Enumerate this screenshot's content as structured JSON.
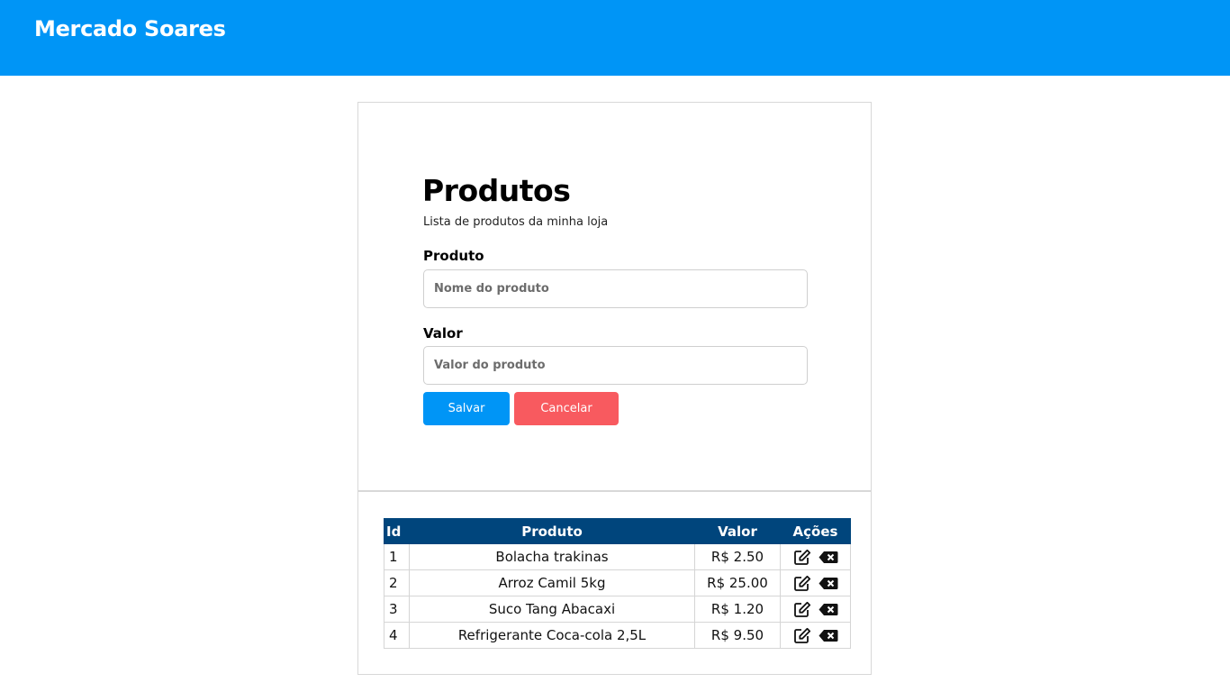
{
  "header": {
    "brand": "Mercado Soares"
  },
  "form": {
    "title": "Produtos",
    "subtitle": "Lista de produtos da minha loja",
    "product_label": "Produto",
    "product_placeholder": "Nome do produto",
    "value_label": "Valor",
    "value_placeholder": "Valor do produto",
    "save_label": "Salvar",
    "cancel_label": "Cancelar"
  },
  "table": {
    "headers": [
      "Id",
      "Produto",
      "Valor",
      "Ações"
    ],
    "rows": [
      {
        "id": "1",
        "produto": "Bolacha trakinas",
        "valor": "R$ 2.50"
      },
      {
        "id": "2",
        "produto": "Arroz Camil 5kg",
        "valor": "R$ 25.00"
      },
      {
        "id": "3",
        "produto": "Suco Tang Abacaxi",
        "valor": "R$ 1.20"
      },
      {
        "id": "4",
        "produto": "Refrigerante Coca-cola 2,5L",
        "valor": "R$ 9.50"
      }
    ],
    "action_icons": [
      "edit-icon",
      "delete-icon"
    ]
  },
  "colors": {
    "primary": "#0095f6",
    "danger": "#f85a5f",
    "table_header": "#00457c"
  }
}
